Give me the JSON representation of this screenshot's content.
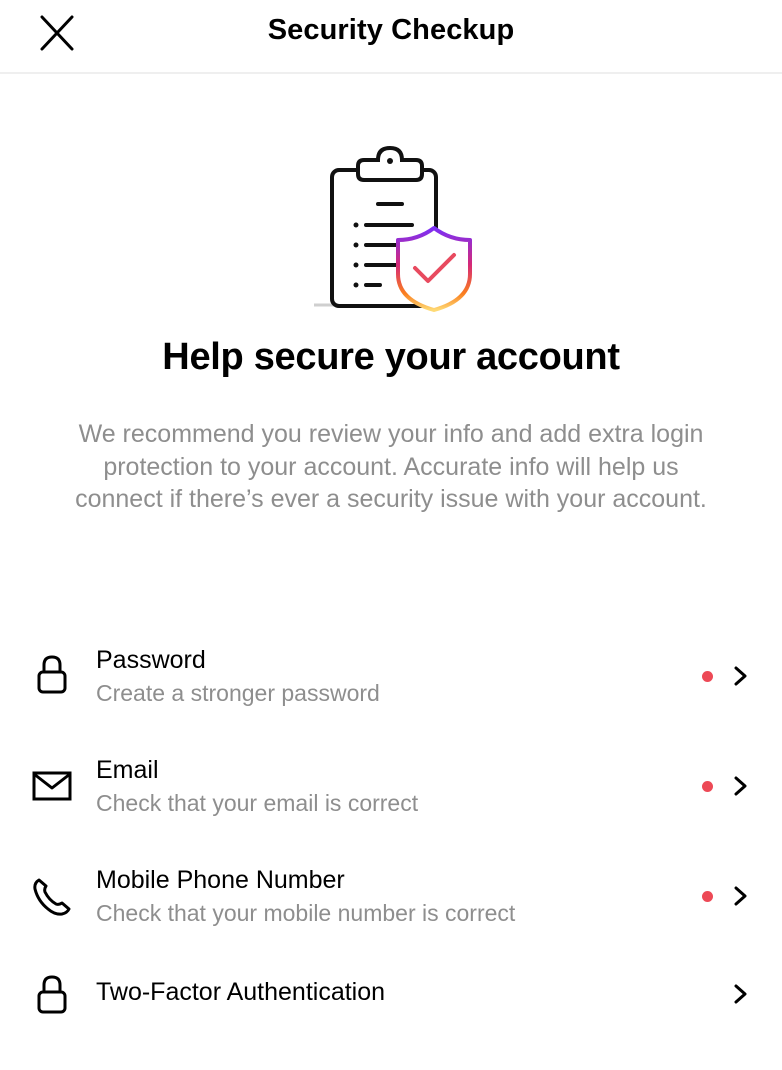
{
  "header": {
    "title": "Security Checkup",
    "close_icon": "close-icon"
  },
  "illustration": {
    "name": "clipboard-with-shield-check",
    "shield_gradient": [
      "#7b2ff7",
      "#c13584",
      "#e1306c",
      "#fd7e14",
      "#fcaf45"
    ]
  },
  "main": {
    "headline": "Help secure your account",
    "description": "We recommend you review your info and add extra login protection to your account. Accurate info will help us connect if there’s ever a security issue with your account."
  },
  "colors": {
    "alert_dot": "#ed4956",
    "secondary_text": "#8e8e8e",
    "divider": "#efefef"
  },
  "items": [
    {
      "icon": "lock-icon",
      "title": "Password",
      "subtitle": "Create a stronger password",
      "alert": true
    },
    {
      "icon": "mail-icon",
      "title": "Email",
      "subtitle": "Check that your email is correct",
      "alert": true
    },
    {
      "icon": "phone-icon",
      "title": "Mobile Phone Number",
      "subtitle": "Check that your mobile number is correct",
      "alert": true
    },
    {
      "icon": "lock-icon",
      "title": "Two-Factor Authentication",
      "subtitle": "",
      "alert": false
    }
  ]
}
